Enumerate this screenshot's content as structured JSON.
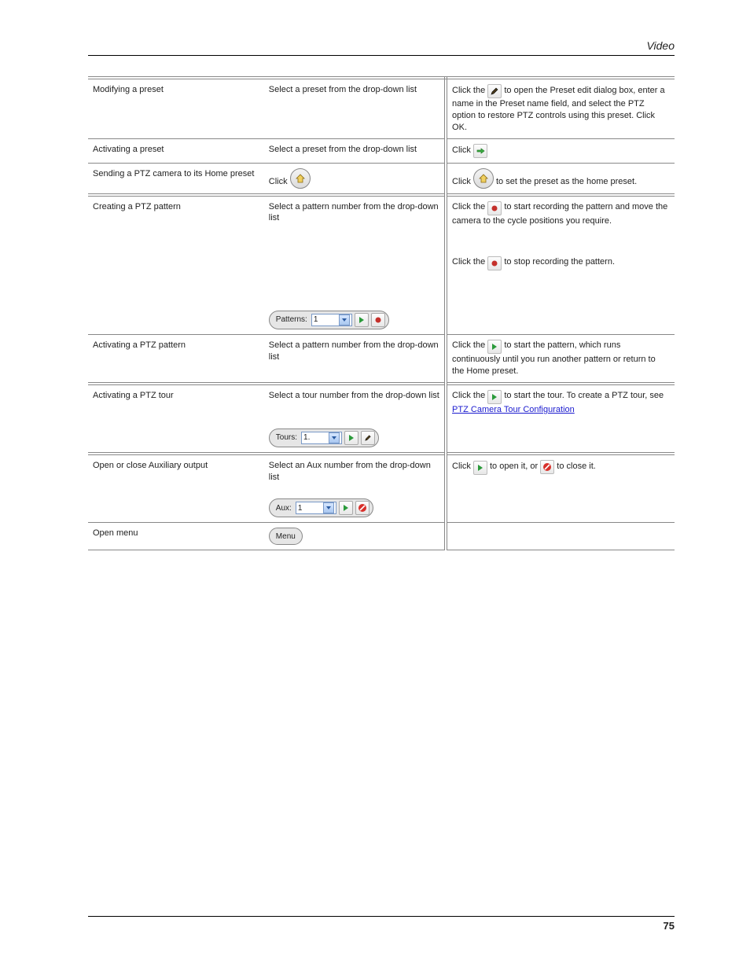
{
  "header": {
    "title": "Video"
  },
  "footer": {
    "page_number": "75"
  },
  "rows": [
    {
      "c1": "Modifying a preset",
      "c2": "Select a preset from the drop-down list",
      "c3a": "Click the ",
      "c3b": " to open the Preset edit dialog box, enter a name in the Preset name field, and select the PTZ option to restore PTZ controls using this preset. Click OK.",
      "edit_icon": "edit-icon"
    },
    {
      "c1": "Activating a preset",
      "c2": "Select a preset from the drop-down list",
      "c3a": "Click ",
      "c3b": ""
    },
    {
      "c1": "Sending a PTZ camera to its Home preset",
      "c2a": "Click ",
      "c2b": "",
      "c3a": "Click ",
      "c3b": " to set the preset as the home preset."
    },
    {
      "sep": "double",
      "c1": "Creating a PTZ pattern",
      "c2a": "Select a pattern number from the drop-down list",
      "c2b": "",
      "c3a": "Click the ",
      "c3b": " to start recording the pattern and move the camera to the cycle positions you require.",
      "c3c": "Click the ",
      "c3d": " to stop recording the pattern."
    },
    {
      "c1": "Activating a PTZ pattern",
      "c2": "Select a pattern number from the drop-down list",
      "c3a": "Click the ",
      "c3b": " to start the pattern, which runs continuously until you run another pattern or return to the Home preset."
    },
    {
      "sep": "double",
      "c1": "Activating a PTZ tour",
      "c2a": "Select a tour number from the drop-down list",
      "c2b": "",
      "c3a": "Click the ",
      "c3b": " to start the tour. To create a PTZ tour, see ",
      "c3link": "PTZ Camera Tour Configuration"
    },
    {
      "sep": "double",
      "c1": "Open or close Auxiliary output",
      "c2a": "Select an Aux number from the drop-down list",
      "c2b": "",
      "c3a": "Click ",
      "c3b": " to open it, or ",
      "c3c": " to close it."
    },
    {
      "c1": "Open menu",
      "c2": "",
      "c3": ""
    }
  ],
  "pills": {
    "patterns": {
      "label": "Patterns:",
      "value": "1"
    },
    "tours": {
      "label": "Tours:",
      "value": "1."
    },
    "aux": {
      "label": "Aux:",
      "value": "1"
    },
    "menu": {
      "label": "Menu"
    }
  },
  "icons": {
    "edit": "edit-icon",
    "arrow_right": "arrow-right-icon",
    "home": "home-icon",
    "record": "record-icon",
    "play": "play-icon",
    "stop": "stop-icon",
    "chevron_down": "chevron-down-icon"
  }
}
